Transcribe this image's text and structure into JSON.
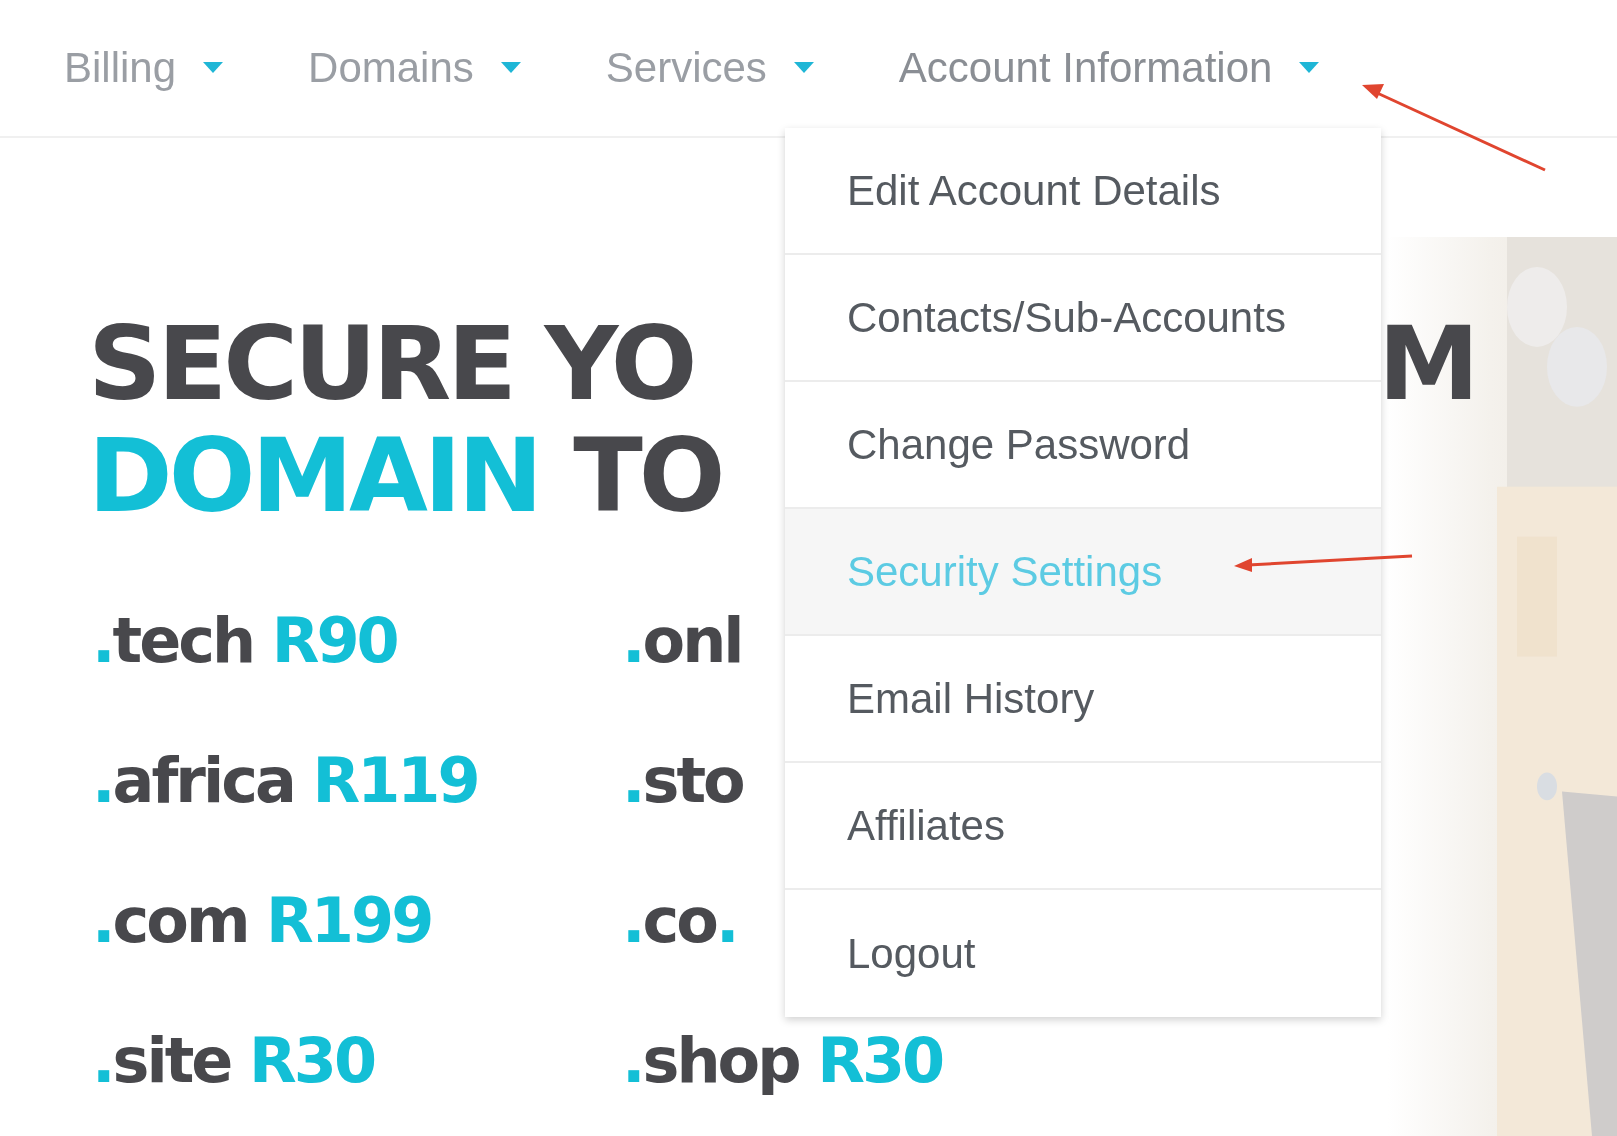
{
  "nav": [
    {
      "label": "Billing",
      "expanded": false
    },
    {
      "label": "Domains",
      "expanded": false
    },
    {
      "label": "Services",
      "expanded": false
    },
    {
      "label": "Account Information",
      "expanded": true
    }
  ],
  "dropdown": [
    {
      "label": "Edit Account Details",
      "selected": false
    },
    {
      "label": "Contacts/Sub-Accounts",
      "selected": false
    },
    {
      "label": "Change Password",
      "selected": false
    },
    {
      "label": "Security Settings",
      "selected": true
    },
    {
      "label": "Email History",
      "selected": false
    },
    {
      "label": "Affiliates",
      "selected": false
    },
    {
      "label": "Logout",
      "selected": false
    }
  ],
  "hero": {
    "line_1": "SECURE YO",
    "line_1_end": "M",
    "line_2_accent": "DOMAIN",
    "line_2": "TO"
  },
  "prices": [
    {
      "tld": ".tech",
      "price": "R90"
    },
    {
      "tld": ".onl"
    },
    {
      "tld": ".africa",
      "price": "R119"
    },
    {
      "tld": ".sto"
    },
    {
      "tld": ".com",
      "price": "R199"
    },
    {
      "tld": ".co."
    },
    {
      "tld": ".site",
      "price": "R30"
    },
    {
      "tld": ".shop",
      "price": "R30"
    }
  ]
}
